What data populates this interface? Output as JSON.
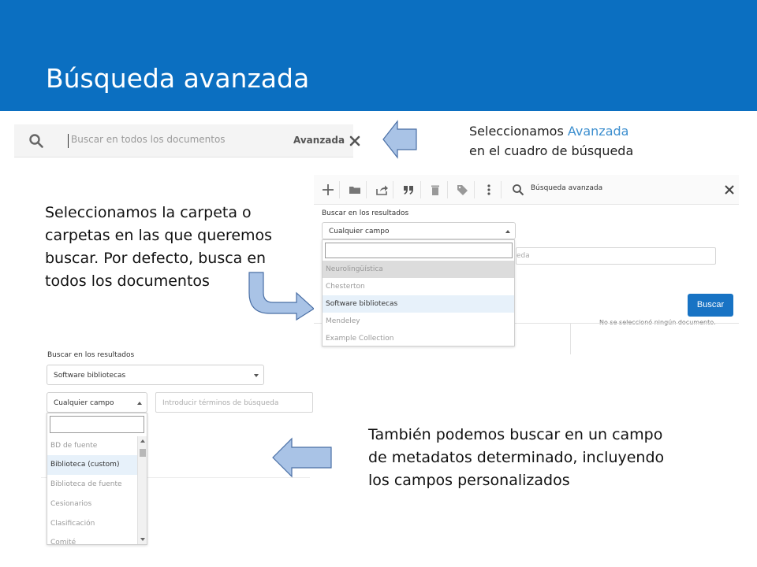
{
  "header": {
    "title": "Búsqueda avanzada",
    "bg_color": "#0b6fc1"
  },
  "search_bar": {
    "placeholder": "Buscar en todos los documentos",
    "advanced_label": "Avanzada",
    "icons": [
      "search-icon",
      "close-icon"
    ]
  },
  "notes": {
    "step1_line1_prefix": "Seleccionamos",
    "step1_line1_accent": "Avanzada",
    "step1_line2": "en el cuadro de búsqueda",
    "step2_lines": [
      "Seleccionamos la carpeta o",
      "carpetas en las que queremos",
      "buscar. Por defecto, busca en",
      "todos los documentos"
    ],
    "step3_lines": [
      "También podemos buscar en un campo",
      "de metadatos determinado, incluyendo",
      "los campos personalizados"
    ]
  },
  "panel_top": {
    "toolbar_icons": [
      "plus-icon",
      "folder-icon",
      "share-icon",
      "quote-icon",
      "trash-icon",
      "tag-icon",
      "more-icon",
      "search-icon",
      "close-icon"
    ],
    "search_label": "Búsqueda avanzada",
    "section_label": "Buscar en los resultados",
    "select_value": "Cualquier campo",
    "field_hint_fragment": "eda",
    "search_button": "Buscar",
    "no_doc_text": "No se seleccionó ningún documento.",
    "dropdown_options": [
      "Neurolingüística",
      "Chesterton",
      "Software bibliotecas",
      "Mendeley",
      "Example Collection"
    ],
    "selected_option": "Software bibliotecas"
  },
  "panel_bottom": {
    "section_label": "Buscar en los resultados",
    "collection_value": "Software bibliotecas",
    "field_select_value": "Cualquier campo",
    "terms_placeholder": "Introducir términos de búsqueda",
    "dropdown_options": [
      "BD de fuente",
      "Biblioteca (custom)",
      "Biblioteca de fuente",
      "Cesionarios",
      "Clasificación",
      "Comité"
    ],
    "selected_option": "Biblioteca (custom)"
  },
  "colors": {
    "accent": "#3d8fcf",
    "button": "#1873c4",
    "arrow_fill": "#a9c3e6",
    "arrow_stroke": "#4a6fa5"
  }
}
